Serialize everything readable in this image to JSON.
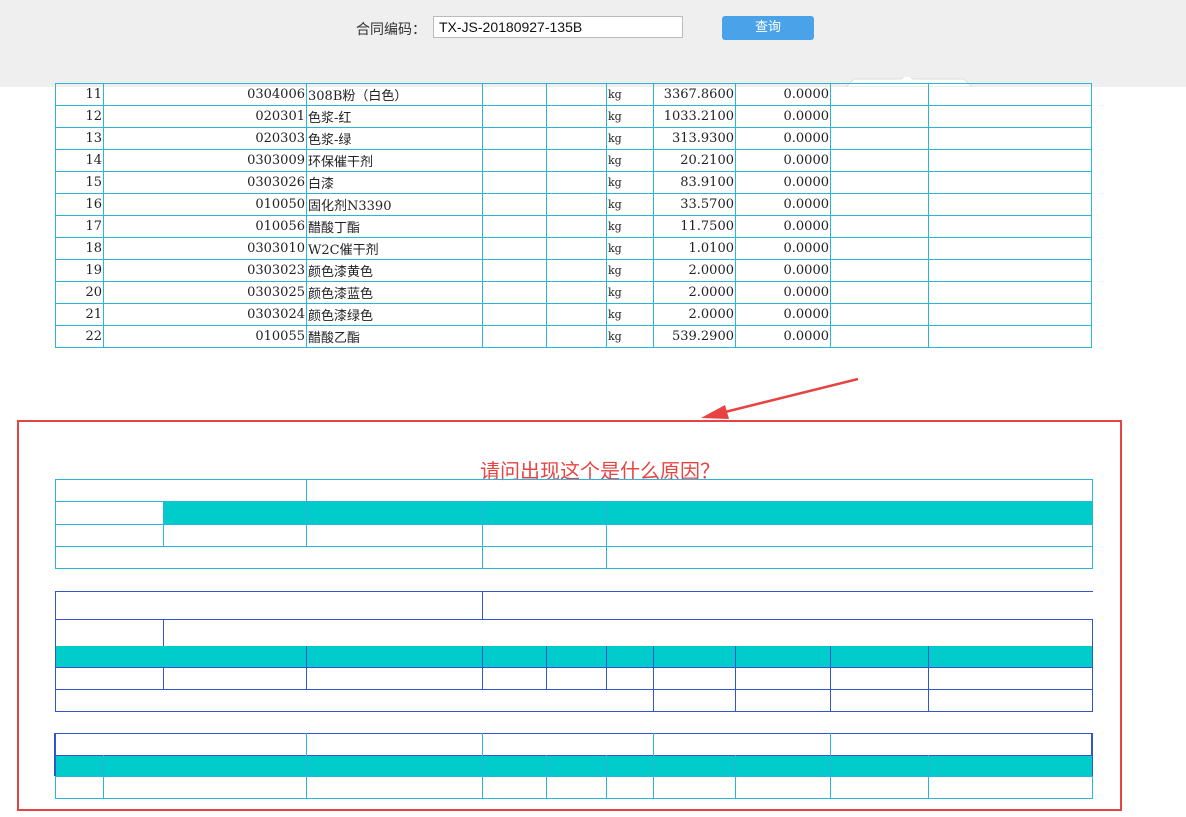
{
  "query": {
    "label": "合同编码：",
    "value": "TX-JS-20180927-135B",
    "button": "查询"
  },
  "table": {
    "rows": [
      {
        "no": "11",
        "code": "0304006",
        "name": "308B粉（白色）",
        "unit": "kg",
        "qty": "3367.8600",
        "amt": "0.0000"
      },
      {
        "no": "12",
        "code": "020301",
        "name": "色浆-红",
        "unit": "kg",
        "qty": "1033.2100",
        "amt": "0.0000"
      },
      {
        "no": "13",
        "code": "020303",
        "name": "色浆-绿",
        "unit": "kg",
        "qty": "313.9300",
        "amt": "0.0000"
      },
      {
        "no": "14",
        "code": "0303009",
        "name": "环保催干剂",
        "unit": "kg",
        "qty": "20.2100",
        "amt": "0.0000"
      },
      {
        "no": "15",
        "code": "0303026",
        "name": "白漆",
        "unit": "kg",
        "qty": "83.9100",
        "amt": "0.0000"
      },
      {
        "no": "16",
        "code": "010050",
        "name": "固化剂N3390",
        "unit": "kg",
        "qty": "33.5700",
        "amt": "0.0000"
      },
      {
        "no": "17",
        "code": "010056",
        "name": "醋酸丁酯",
        "unit": "kg",
        "qty": "11.7500",
        "amt": "0.0000"
      },
      {
        "no": "18",
        "code": "0303010",
        "name": "W2C催干剂",
        "unit": "kg",
        "qty": "1.0100",
        "amt": "0.0000"
      },
      {
        "no": "19",
        "code": "0303023",
        "name": "颜色漆黄色",
        "unit": "kg",
        "qty": "2.0000",
        "amt": "0.0000"
      },
      {
        "no": "20",
        "code": "0303025",
        "name": "颜色漆蓝色",
        "unit": "kg",
        "qty": "2.0000",
        "amt": "0.0000"
      },
      {
        "no": "21",
        "code": "0303024",
        "name": "颜色漆绿色",
        "unit": "kg",
        "qty": "2.0000",
        "amt": "0.0000"
      },
      {
        "no": "22",
        "code": "010055",
        "name": "醋酸乙酯",
        "unit": "kg",
        "qty": "539.2900",
        "amt": "0.0000"
      }
    ]
  },
  "annotation": {
    "question": "请问出现这个是什么原因？"
  },
  "colors": {
    "border": "#29b6d8",
    "fill": "#00cccc",
    "alert": "#e84343",
    "button": "#4aa3e8",
    "grid_blue": "#3355cc"
  }
}
